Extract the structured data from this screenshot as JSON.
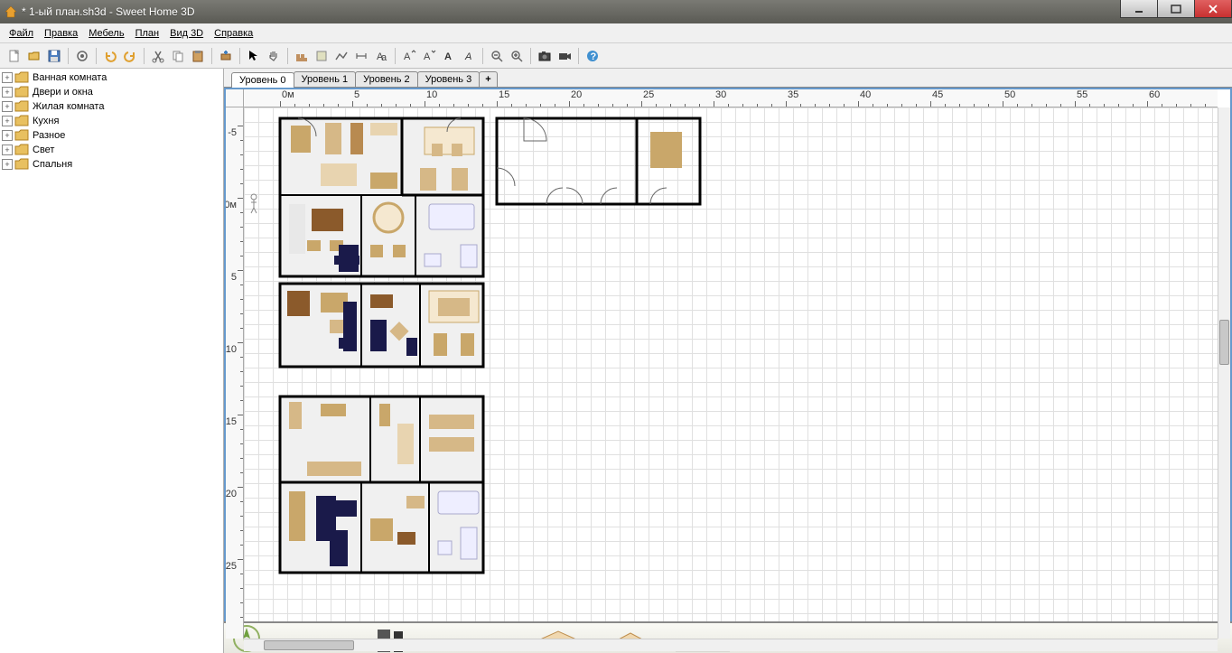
{
  "window": {
    "title": "* 1-ый план.sh3d - Sweet Home 3D"
  },
  "menus": [
    "Файл",
    "Правка",
    "Мебель",
    "План",
    "Вид 3D",
    "Справка"
  ],
  "toolbar_icons": [
    "new-file",
    "open-file",
    "save-file",
    "sep",
    "settings",
    "sep",
    "undo",
    "redo",
    "sep",
    "cut",
    "copy",
    "paste",
    "sep",
    "add-furniture",
    "sep",
    "pointer",
    "pan",
    "sep",
    "draw-wall",
    "draw-room",
    "draw-polyline",
    "dimension",
    "text",
    "sep",
    "text-bold",
    "text-italic",
    "sep",
    "compass",
    "rotate",
    "sep",
    "zoom-out",
    "zoom-in",
    "sep",
    "photo",
    "video",
    "sep",
    "help"
  ],
  "catalog": [
    {
      "label": "Ванная комната"
    },
    {
      "label": "Двери и окна"
    },
    {
      "label": "Жилая комната"
    },
    {
      "label": "Кухня"
    },
    {
      "label": "Разное"
    },
    {
      "label": "Свет"
    },
    {
      "label": "Спальня"
    }
  ],
  "levels": {
    "tabs": [
      "Уровень 0",
      "Уровень 1",
      "Уровень 2",
      "Уровень 3"
    ],
    "active": 0,
    "add": "+"
  },
  "ruler": {
    "h_major": [
      {
        "p": 40,
        "l": "0м"
      },
      {
        "p": 120,
        "l": "5"
      },
      {
        "p": 200,
        "l": "10"
      },
      {
        "p": 280,
        "l": "15"
      },
      {
        "p": 360,
        "l": "20"
      },
      {
        "p": 440,
        "l": "25"
      },
      {
        "p": 520,
        "l": "30"
      },
      {
        "p": 600,
        "l": "35"
      },
      {
        "p": 680,
        "l": "40"
      },
      {
        "p": 760,
        "l": "45"
      },
      {
        "p": 840,
        "l": "50"
      },
      {
        "p": 920,
        "l": "55"
      },
      {
        "p": 1000,
        "l": "60"
      }
    ],
    "v_major": [
      {
        "p": 20,
        "l": "-5"
      },
      {
        "p": 100,
        "l": "0м"
      },
      {
        "p": 180,
        "l": "5"
      },
      {
        "p": 260,
        "l": "10"
      },
      {
        "p": 340,
        "l": "15"
      },
      {
        "p": 420,
        "l": "20"
      },
      {
        "p": 500,
        "l": "25"
      }
    ]
  }
}
